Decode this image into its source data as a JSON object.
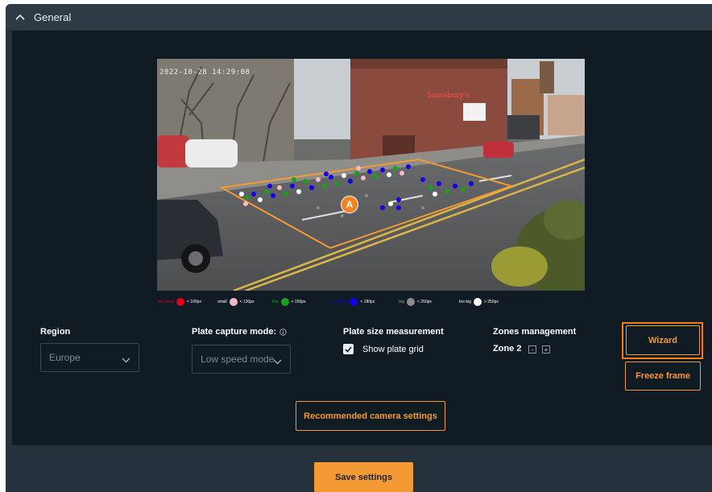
{
  "section": {
    "title": "General"
  },
  "camera": {
    "timestamp": "2022-10-28 14:29:08",
    "zone_marker": "A"
  },
  "legend": [
    {
      "label": "too small",
      "range": "< 100px",
      "color": "#e3001b",
      "label_color": "#e3001b"
    },
    {
      "label": "small",
      "range": "< 130px",
      "color": "#f8b8c8",
      "label_color": "#ffffff"
    },
    {
      "label": "fine",
      "range": "< 150px",
      "color": "#1aa01e",
      "label_color": "#1aa01e"
    },
    {
      "label": "medium",
      "range": "< 180px",
      "color": "#1400e6",
      "label_color": "#1400e6"
    },
    {
      "label": "big",
      "range": "< 250px",
      "color": "#8c8c8c",
      "label_color": "#9a9a9a"
    },
    {
      "label": "too big",
      "range": "> 250px",
      "color": "#ffffff",
      "label_color": "#ffffff"
    }
  ],
  "region": {
    "label": "Region",
    "value": "Europe"
  },
  "plate_capture": {
    "label": "Plate capture mode:",
    "value": "Low speed mode"
  },
  "plate_size": {
    "label": "Plate size measurement",
    "checkbox_label": "Show plate grid",
    "checked": true
  },
  "zones": {
    "label": "Zones management",
    "value": "Zone 2",
    "minus": "-",
    "plus": "+"
  },
  "buttons": {
    "wizard": "Wizard",
    "freeze": "Freeze frame",
    "recommended": "Recommended camera settings",
    "save": "Save settings"
  },
  "colors": {
    "accent": "#f39a34",
    "highlight": "#f07c1f"
  },
  "icons": {
    "collapse": "chevron-up-icon",
    "dropdown": "chevron-down-icon",
    "info": "info-icon",
    "check": "check-icon"
  }
}
